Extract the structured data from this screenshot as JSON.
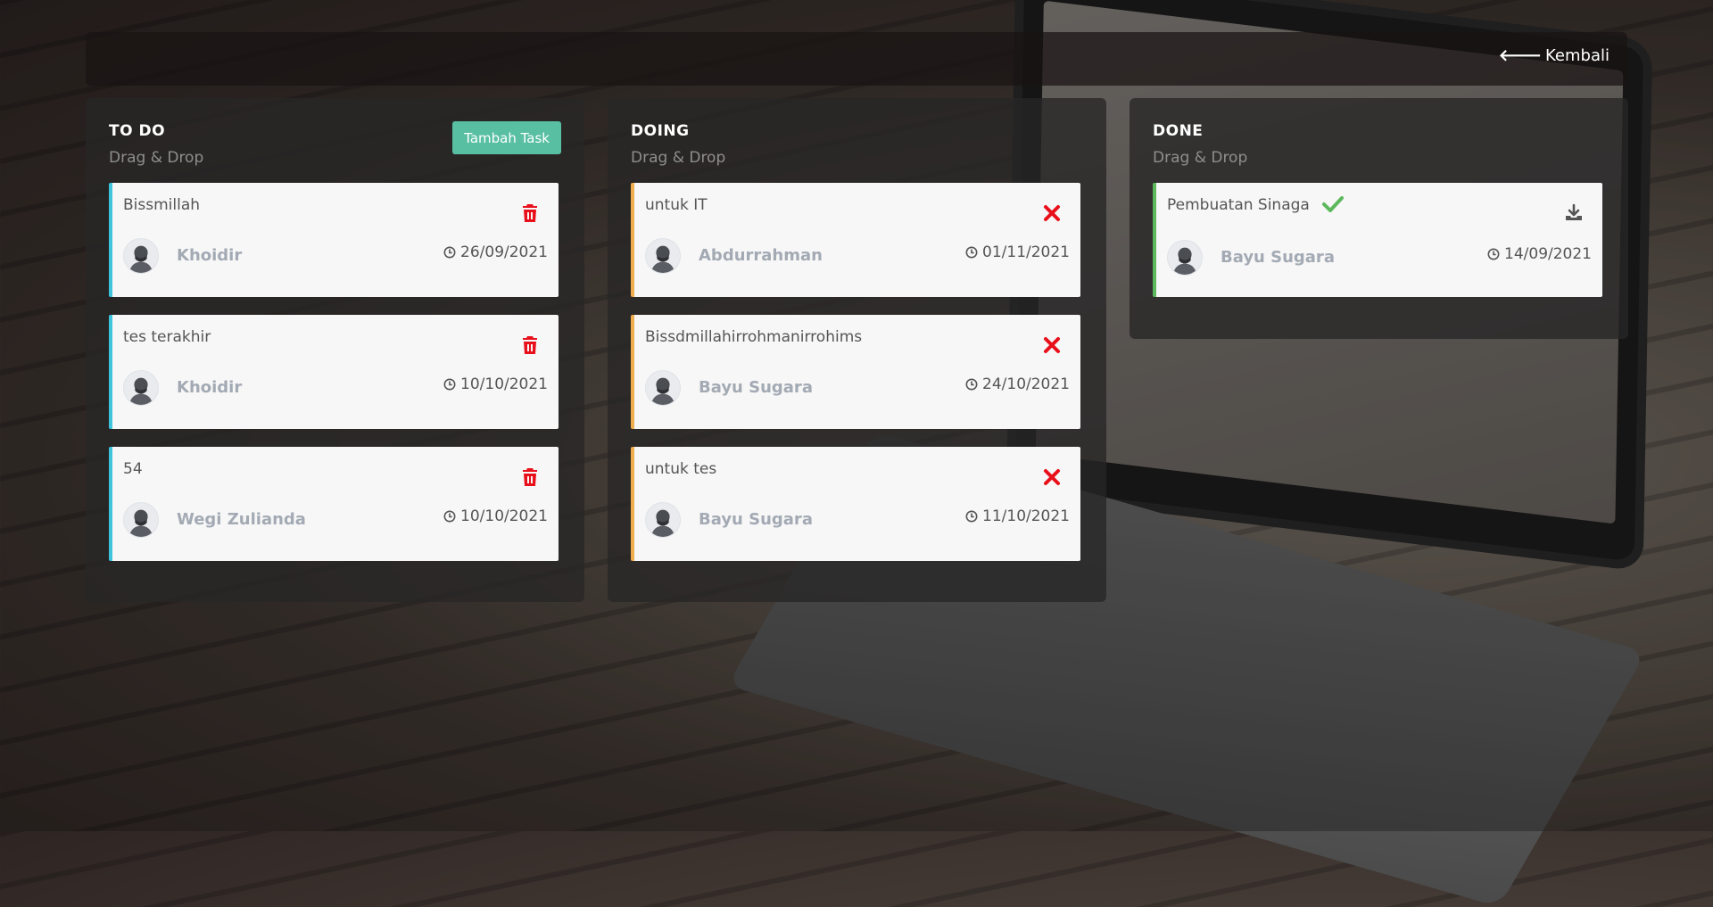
{
  "topbar": {
    "back_label": "Kembali"
  },
  "columns": {
    "todo": {
      "title": "TO DO",
      "subtitle": "Drag & Drop",
      "add_button_label": "Tambah Task",
      "cards": [
        {
          "title": "Bissmillah",
          "assignee": "Khoidir",
          "date": "26/09/2021",
          "action_icon": "trash-icon"
        },
        {
          "title": "tes terakhir",
          "assignee": "Khoidir",
          "date": "10/10/2021",
          "action_icon": "trash-icon"
        },
        {
          "title": "54",
          "assignee": "Wegi Zulianda",
          "date": "10/10/2021",
          "action_icon": "trash-icon"
        }
      ]
    },
    "doing": {
      "title": "DOING",
      "subtitle": "Drag & Drop",
      "cards": [
        {
          "title": "untuk IT",
          "assignee": "Abdurrahman",
          "date": "01/11/2021",
          "action_icon": "x-icon"
        },
        {
          "title": "Bissdmillahirrohmanirrohims",
          "assignee": "Bayu Sugara",
          "date": "24/10/2021",
          "action_icon": "x-icon"
        },
        {
          "title": "untuk tes",
          "assignee": "Bayu Sugara",
          "date": "11/10/2021",
          "action_icon": "x-icon"
        }
      ]
    },
    "done": {
      "title": "DONE",
      "subtitle": "Drag & Drop",
      "cards": [
        {
          "title": "Pembuatan Sinaga",
          "assignee": "Bayu Sugara",
          "date": "14/09/2021",
          "action_icon": "download-icon",
          "status_icon": "check-icon"
        }
      ]
    }
  },
  "colors": {
    "todo_accent": "#3ec5dd",
    "doing_accent": "#f0ad4e",
    "done_accent": "#5cb85c",
    "danger": "#e8101a",
    "add_button": "#58bfa3"
  }
}
